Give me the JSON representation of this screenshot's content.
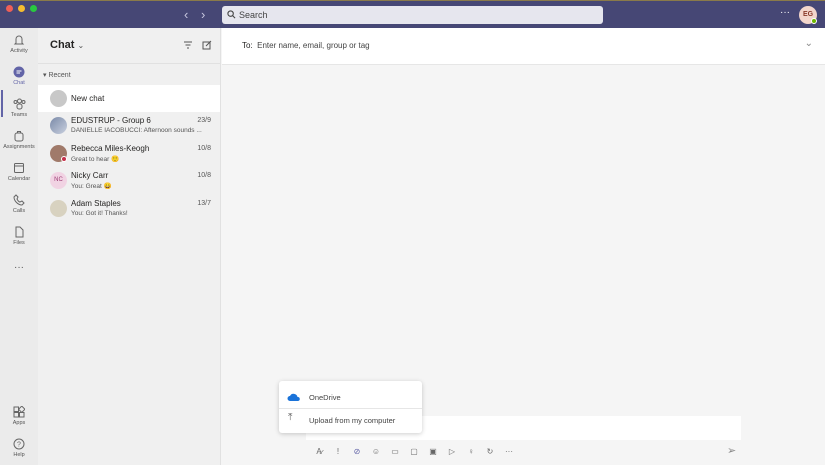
{
  "titlebar": {
    "search_placeholder": "Search",
    "more": "···",
    "user_initials": "EG"
  },
  "rail": {
    "items": [
      {
        "label": "Activity"
      },
      {
        "label": "Chat"
      },
      {
        "label": "Teams"
      },
      {
        "label": "Assignments"
      },
      {
        "label": "Calendar"
      },
      {
        "label": "Calls"
      },
      {
        "label": "Files"
      }
    ],
    "more": "···",
    "apps": "Apps",
    "help": "Help"
  },
  "chat_list": {
    "title": "Chat",
    "section": "Recent",
    "new_chat": "New chat",
    "chats": [
      {
        "name": "EDUSTRUP - Group 6",
        "date": "23/9",
        "preview": "DANIELLE IACOBUCCI: Afternoon sounds ..."
      },
      {
        "name": "Rebecca Miles-Keogh",
        "date": "10/8",
        "preview": "Great to hear 🙂"
      },
      {
        "name": "Nicky Carr",
        "date": "10/8",
        "preview": "You: Great 😄",
        "initials": "NC"
      },
      {
        "name": "Adam Staples",
        "date": "13/7",
        "preview": "You: Got it! Thanks!"
      }
    ]
  },
  "main": {
    "to_label": "To:",
    "to_placeholder": "Enter name, email, group or tag"
  },
  "attach_menu": {
    "items": [
      {
        "label": "OneDrive"
      },
      {
        "label": "Upload from my computer"
      }
    ]
  },
  "toolbar": {
    "more": "···"
  },
  "colors": {
    "titlebar": "#464775",
    "accent": "#6264a7"
  }
}
